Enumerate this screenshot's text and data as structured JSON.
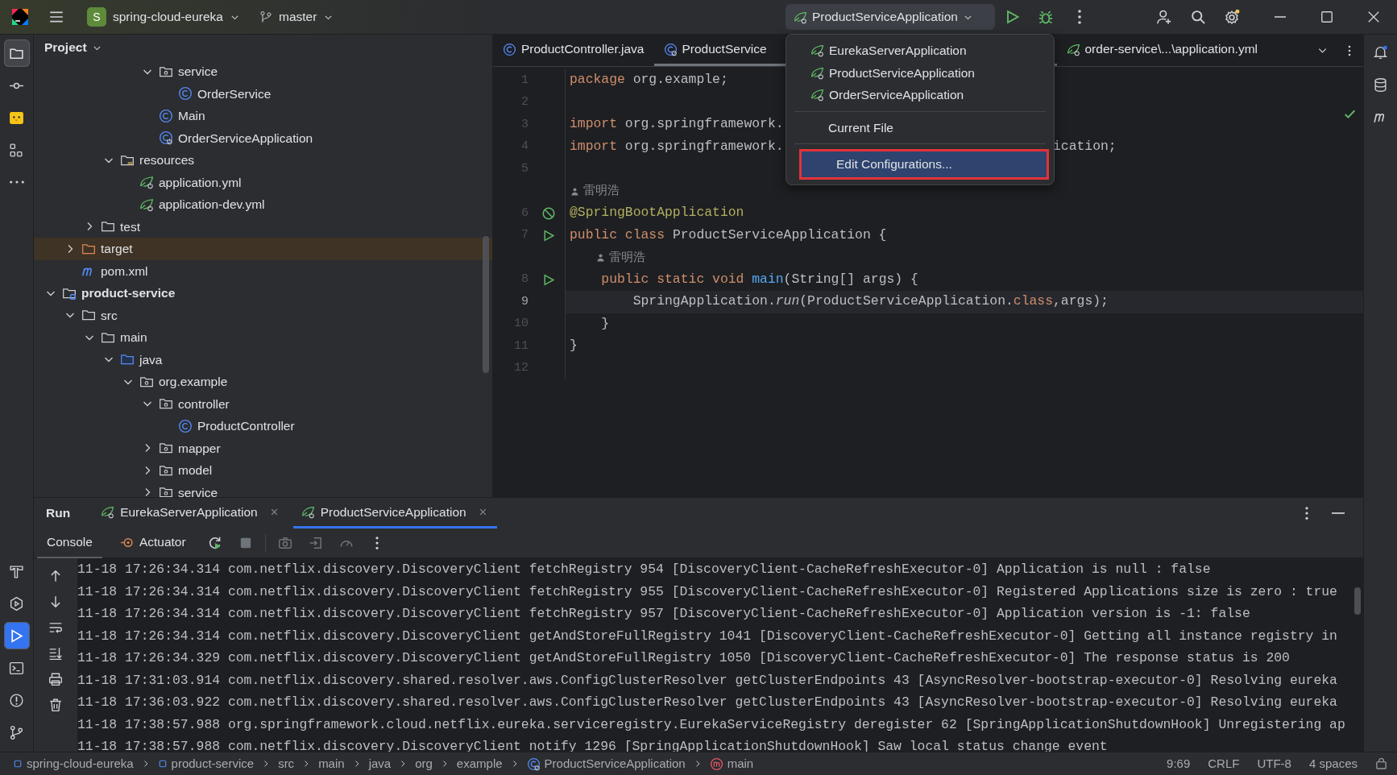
{
  "title_bar": {
    "project_badge": "S",
    "project": "spring-cloud-eureka",
    "branch": "master",
    "run_config": "ProductServiceApplication",
    "run_config_expanded": true
  },
  "left_toolbar": {
    "top": [
      {
        "kind": "project",
        "selected": true,
        "focused": false
      },
      {
        "kind": "commit",
        "selected": false,
        "focused": false
      },
      {
        "kind": "plugin",
        "selected": false,
        "focused": false
      },
      {
        "kind": "structure",
        "selected": false,
        "focused": false
      },
      {
        "kind": "more",
        "selected": false,
        "focused": false
      }
    ],
    "bottom": [
      {
        "kind": "build",
        "selected": false,
        "focused": false
      },
      {
        "kind": "services",
        "selected": false,
        "focused": false
      },
      {
        "kind": "run",
        "selected": true,
        "focused": true
      },
      {
        "kind": "terminal",
        "selected": false,
        "focused": false
      },
      {
        "kind": "problems",
        "selected": false,
        "focused": false
      },
      {
        "kind": "git",
        "selected": false,
        "focused": false
      }
    ]
  },
  "project_panel": {
    "title": "Project",
    "tree": [
      {
        "children": [
          {
            "children": [
              {
                "children": [
                  {
                    "children": [
                      {
                        "children": [
                          {
                            "label": "service",
                            "kind": "package",
                            "expanded": true,
                            "selected": false,
                            "children": [
                              {
                                "label": "OrderService",
                                "kind": "class",
                                "selected": false
                              }
                            ]
                          },
                          {
                            "label": "Main",
                            "kind": "class",
                            "selected": false
                          },
                          {
                            "label": "OrderServiceApplication",
                            "kind": "spring-class",
                            "selected": false
                          }
                        ]
                      }
                    ]
                  },
                  {
                    "label": "resources",
                    "kind": "resources",
                    "expanded": true,
                    "selected": false,
                    "children": [
                      {
                        "label": "application.yml",
                        "kind": "spring-yml",
                        "selected": false
                      },
                      {
                        "label": "application-dev.yml",
                        "kind": "spring-yml",
                        "selected": false
                      }
                    ]
                  }
                ]
              },
              {
                "label": "test",
                "kind": "folder",
                "expanded": false,
                "selected": false
              }
            ]
          },
          {
            "label": "target",
            "kind": "excluded",
            "expanded": false,
            "selected": true
          },
          {
            "label": "pom.xml",
            "kind": "maven",
            "selected": false
          }
        ]
      },
      {
        "label": "product-service",
        "kind": "module",
        "expanded": true,
        "selected": false,
        "children": [
          {
            "label": "src",
            "kind": "folder",
            "expanded": true,
            "selected": false,
            "children": [
              {
                "label": "main",
                "kind": "folder",
                "expanded": true,
                "selected": false,
                "children": [
                  {
                    "label": "java",
                    "kind": "source",
                    "expanded": true,
                    "selected": false,
                    "children": [
                      {
                        "label": "org.example",
                        "kind": "package",
                        "expanded": true,
                        "selected": false,
                        "children": [
                          {
                            "label": "controller",
                            "kind": "package",
                            "expanded": true,
                            "selected": false,
                            "children": [
                              {
                                "label": "ProductController",
                                "kind": "class",
                                "selected": false
                              }
                            ]
                          },
                          {
                            "label": "mapper",
                            "kind": "package",
                            "expanded": false,
                            "selected": false
                          },
                          {
                            "label": "model",
                            "kind": "package",
                            "expanded": false,
                            "selected": false
                          },
                          {
                            "label": "service",
                            "kind": "package",
                            "expanded": false,
                            "selected": false
                          }
                        ]
                      }
                    ]
                  }
                ]
              }
            ]
          }
        ]
      }
    ]
  },
  "editor": {
    "tabs": [
      {
        "label": "ProductController.java",
        "kind": "class",
        "selected": false
      },
      {
        "label": "ProductService",
        "kind": "spring-class",
        "selected": true
      },
      {
        "label": "order-service\\...\\application.yml",
        "kind": "spring-yml",
        "selected": false
      }
    ],
    "lines": [
      {
        "number": "1",
        "current": false,
        "tokens": [
          {
            "t": "package",
            "kind": "keyword"
          },
          {
            "t": " org.example;"
          }
        ]
      },
      {
        "number": "2",
        "current": false
      },
      {
        "number": "3",
        "current": false,
        "tokens": [
          {
            "t": "import",
            "kind": "keyword"
          },
          {
            "t": " org.springframework."
          }
        ]
      },
      {
        "number": "4",
        "current": false,
        "tokens": [
          {
            "t": "import",
            "kind": "keyword"
          },
          {
            "t": " org.springframework."
          },
          {
            "kind": "covered"
          },
          {
            "t": "ication;"
          }
        ]
      },
      {
        "number": "5",
        "current": false
      },
      {
        "number": "6",
        "current": false,
        "author": "雷明浩",
        "gutter": {
          "kind": "bean"
        },
        "tokens": [
          {
            "t": "@SpringBootApplication",
            "kind": "annotation"
          }
        ]
      },
      {
        "number": "7",
        "current": false,
        "gutter": {
          "kind": "run"
        },
        "tokens": [
          {
            "t": "public class",
            "kind": "keyword"
          },
          {
            "t": " ProductServiceApplication {"
          }
        ]
      },
      {
        "number": "8",
        "current": false,
        "author": "雷明浩",
        "gutter": {
          "kind": "run"
        },
        "tokens": [
          {
            "t": "    public static void",
            "kind": "keyword"
          },
          {
            "t": " main",
            "kind": "method"
          },
          {
            "t": "(String[] args) {"
          }
        ]
      },
      {
        "number": "9",
        "current": true,
        "tokens": [
          {
            "t": "        SpringApplication."
          },
          {
            "t": "run",
            "kind": "italic"
          },
          {
            "t": "(ProductServiceApplication."
          },
          {
            "t": "class",
            "kind": "keyword"
          },
          {
            "t": ",args);"
          }
        ]
      },
      {
        "number": "10",
        "current": false,
        "tokens": [
          {
            "t": "    }"
          }
        ]
      },
      {
        "number": "11",
        "current": false,
        "tokens": [
          {
            "t": "}"
          }
        ]
      },
      {
        "number": "12",
        "current": false
      }
    ]
  },
  "run_menu": {
    "items": [
      {
        "kind": "config",
        "label": "EurekaServerApplication",
        "selected": false,
        "outlined": false
      },
      {
        "kind": "config",
        "label": "ProductServiceApplication",
        "selected": false,
        "outlined": false
      },
      {
        "kind": "config",
        "label": "OrderServiceApplication",
        "selected": false,
        "outlined": false
      },
      {
        "kind": "separator"
      },
      {
        "kind": "action",
        "label": "Current File",
        "selected": false,
        "outlined": false
      },
      {
        "kind": "separator"
      },
      {
        "kind": "action",
        "label": "Edit Configurations...",
        "selected": true,
        "outlined": true
      }
    ]
  },
  "run_panel": {
    "title": "Run",
    "tabs": [
      {
        "label": "EurekaServerApplication",
        "selected": false
      },
      {
        "label": "ProductServiceApplication",
        "selected": true
      }
    ],
    "subtabs": [
      {
        "label": "Console",
        "kind": "console",
        "selected": true
      },
      {
        "label": "Actuator",
        "kind": "actuator",
        "selected": false
      }
    ],
    "console": [
      "11-18 17:26:34.314 com.netflix.discovery.DiscoveryClient fetchRegistry 954 [DiscoveryClient-CacheRefreshExecutor-0] Application is null : false",
      "11-18 17:26:34.314 com.netflix.discovery.DiscoveryClient fetchRegistry 955 [DiscoveryClient-CacheRefreshExecutor-0] Registered Applications size is zero : true",
      "11-18 17:26:34.314 com.netflix.discovery.DiscoveryClient fetchRegistry 957 [DiscoveryClient-CacheRefreshExecutor-0] Application version is -1: false",
      "11-18 17:26:34.314 com.netflix.discovery.DiscoveryClient getAndStoreFullRegistry 1041 [DiscoveryClient-CacheRefreshExecutor-0] Getting all instance registry in",
      "11-18 17:26:34.329 com.netflix.discovery.DiscoveryClient getAndStoreFullRegistry 1050 [DiscoveryClient-CacheRefreshExecutor-0] The response status is 200",
      "11-18 17:31:03.914 com.netflix.discovery.shared.resolver.aws.ConfigClusterResolver getClusterEndpoints 43 [AsyncResolver-bootstrap-executor-0] Resolving eureka",
      "11-18 17:36:03.922 com.netflix.discovery.shared.resolver.aws.ConfigClusterResolver getClusterEndpoints 43 [AsyncResolver-bootstrap-executor-0] Resolving eureka",
      "11-18 17:38:57.988 org.springframework.cloud.netflix.eureka.serviceregistry.EurekaServiceRegistry deregister 62 [SpringApplicationShutdownHook] Unregistering ap",
      "11-18 17:38:57.988 com.netflix.discovery.DiscoveryClient notify 1296 [SpringApplicationShutdownHook] Saw local status change event"
    ]
  },
  "status_bar": {
    "breadcrumbs": [
      {
        "label": "spring-cloud-eureka",
        "kind": "module"
      },
      {
        "label": "product-service",
        "kind": "module"
      },
      {
        "label": "src",
        "kind": "plain"
      },
      {
        "label": "main",
        "kind": "plain"
      },
      {
        "label": "java",
        "kind": "plain"
      },
      {
        "label": "org",
        "kind": "plain"
      },
      {
        "label": "example",
        "kind": "plain"
      },
      {
        "label": "ProductServiceApplication",
        "kind": "spring-class"
      },
      {
        "label": "main",
        "kind": "method"
      }
    ],
    "position": "9:69",
    "line_ending": "CRLF",
    "encoding": "UTF-8",
    "indent": "4 spaces"
  }
}
